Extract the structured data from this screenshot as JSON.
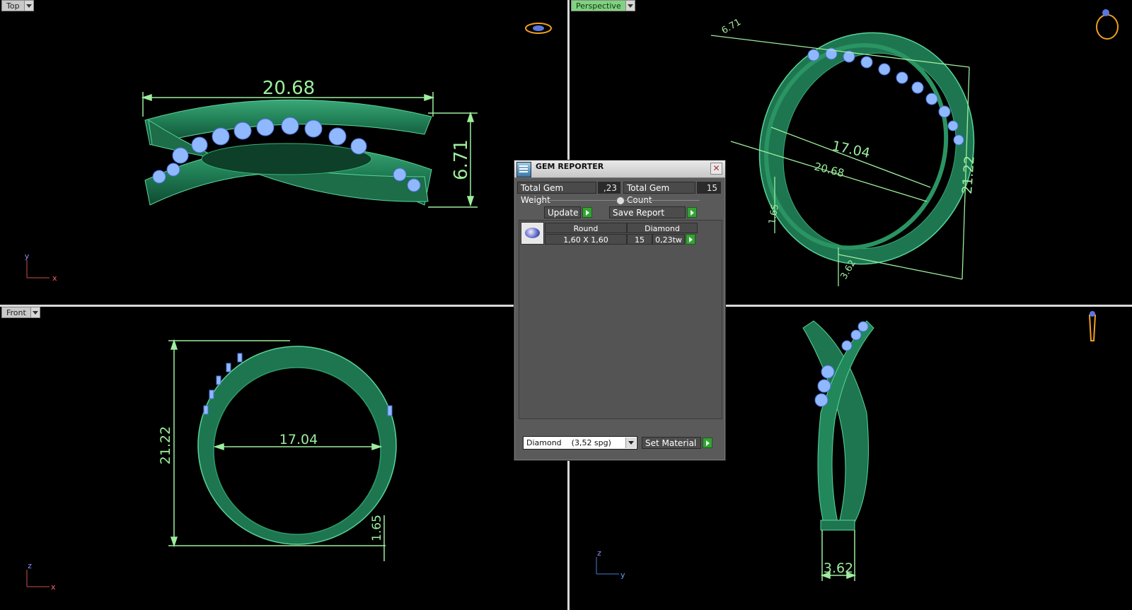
{
  "viewports": {
    "top": {
      "label": "Top",
      "dim_width": "20.68",
      "dim_height": "6.71",
      "axis_v": "y",
      "axis_h": "x"
    },
    "perspective": {
      "label": "Perspective",
      "dim_a": "6.71",
      "dim_inner": "17.04",
      "dim_outer": "20.68",
      "dim_height": "21.22",
      "dim_band": "1.65",
      "dim_width": "3.62"
    },
    "front": {
      "label": "Front",
      "dim_height": "21.22",
      "dim_inner": "17.04",
      "dim_band": "1.65",
      "axis_v": "z",
      "axis_h": "x"
    },
    "right": {
      "dim_width": "3.62",
      "axis_v": "z",
      "axis_h": "y"
    }
  },
  "gem_reporter": {
    "title": "GEM REPORTER",
    "total_weight_label": "Total Gem Weight",
    "total_weight_value": ",23",
    "total_count_label": "Total Gem Count",
    "total_count_value": "15",
    "update_label": "Update",
    "save_label": "Save Report",
    "row": {
      "shape": "Round",
      "material": "Diamond",
      "size": "1,60 X 1,60",
      "count": "15",
      "weight": "0,23tw"
    },
    "material_select": "Diamond    (3,52 spg)",
    "set_material_label": "Set Material"
  },
  "colors": {
    "metal": "#1f7a52",
    "gem": "#8fb8ff",
    "dimension": "#9dee9d",
    "active_tab": "#7fd27f"
  }
}
